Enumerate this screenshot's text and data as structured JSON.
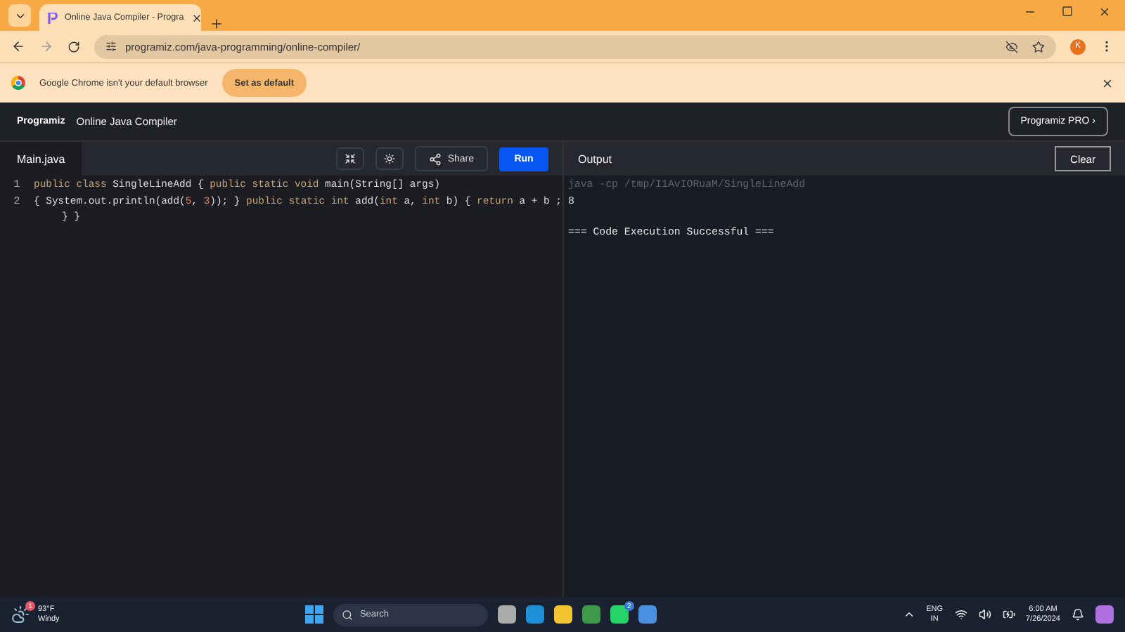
{
  "browser": {
    "tab": {
      "title": "Online Java Compiler - Progra",
      "selected": true
    },
    "url": "programiz.com/java-programming/online-compiler/",
    "profile_initial": "K"
  },
  "infobar": {
    "message": "Google Chrome isn't your default browser",
    "button": "Set as default"
  },
  "header": {
    "logo": "Programiz",
    "title": "Online Java Compiler",
    "pro_button": "Programiz PRO ›"
  },
  "editor": {
    "file_tab": "Main.java",
    "share_button": "Share",
    "run_button": "Run",
    "lines": [
      {
        "number": "1",
        "tokens": [
          {
            "kind": "keyword",
            "text": "public class "
          },
          {
            "kind": "plain",
            "text": "SingleLineAdd { "
          },
          {
            "kind": "keyword",
            "text": "public static void "
          },
          {
            "kind": "plain",
            "text": "main(String[] args)"
          }
        ]
      },
      {
        "number": "2",
        "tokens": [
          {
            "kind": "plain",
            "text": "{ System.out.println(add("
          },
          {
            "kind": "number",
            "text": "5"
          },
          {
            "kind": "plain",
            "text": ", "
          },
          {
            "kind": "number",
            "text": "3"
          },
          {
            "kind": "plain",
            "text": ")); } "
          },
          {
            "kind": "keyword",
            "text": "public static int "
          },
          {
            "kind": "plain",
            "text": "add("
          },
          {
            "kind": "keyword",
            "text": "int "
          },
          {
            "kind": "plain",
            "text": "a, "
          },
          {
            "kind": "keyword",
            "text": "int "
          },
          {
            "kind": "plain",
            "text": "b) { "
          },
          {
            "kind": "keyword",
            "text": "return "
          },
          {
            "kind": "plain",
            "text": "a + b ; } }"
          }
        ]
      }
    ]
  },
  "output": {
    "title": "Output",
    "clear_button": "Clear",
    "lines": [
      {
        "kind": "command",
        "text": "java -cp /tmp/I1AvIORuaM/SingleLineAdd"
      },
      {
        "kind": "result",
        "text": "8"
      },
      {
        "kind": "status",
        "text": "=== Code Execution Successful ==="
      }
    ]
  },
  "taskbar": {
    "weather": {
      "temp": "93°F",
      "condition": "Windy",
      "badge": "1"
    },
    "search": {
      "placeholder": "Search"
    },
    "whatsapp_badge": "2",
    "language": [
      "ENG",
      "IN"
    ],
    "time": "6:00 AM",
    "date": "7/26/2024"
  }
}
